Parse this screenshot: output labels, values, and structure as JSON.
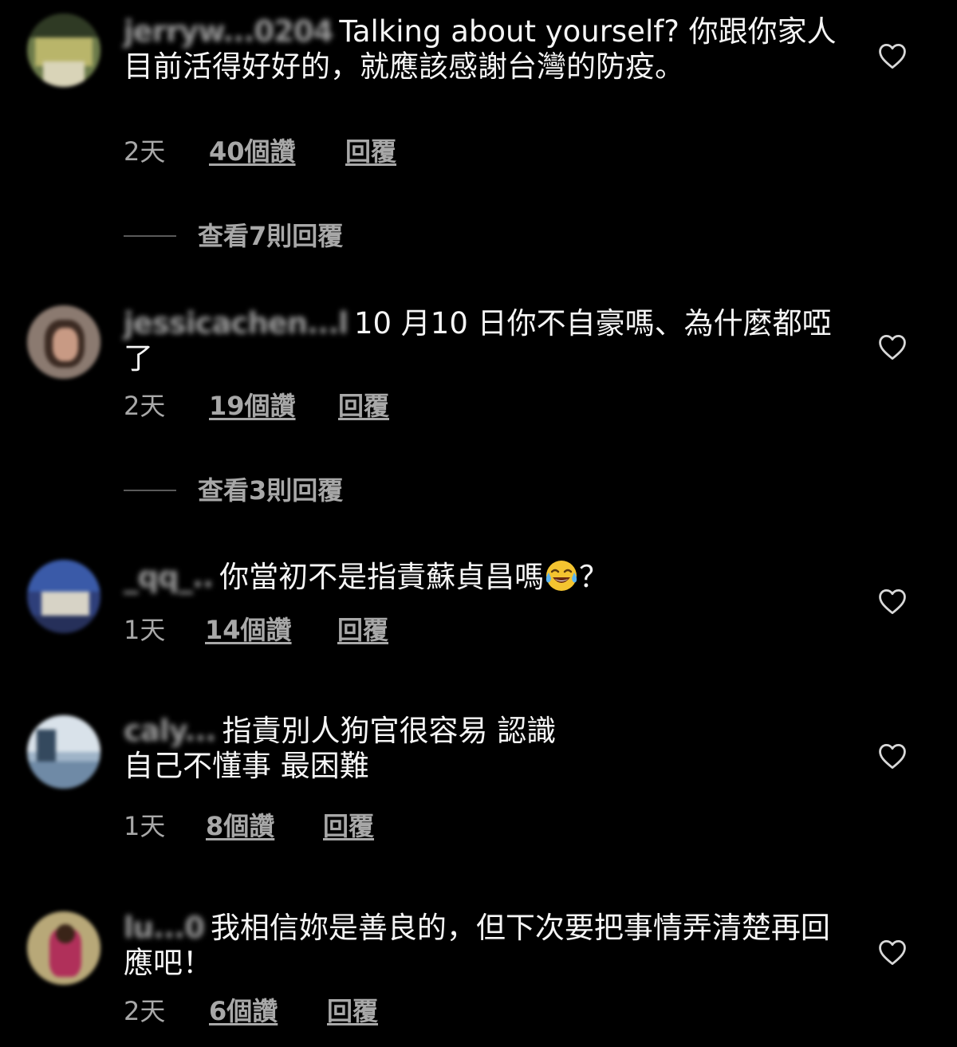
{
  "colors": {
    "background": "#000000",
    "text": "#f5f5f5",
    "meta": "#a8a8a8",
    "divider": "#5a5a5a"
  },
  "comments": [
    {
      "username": "jerryw...0204",
      "text": "Talking about yourself? 你跟你家人目前活得好好的，就應該感謝台灣的防疫。",
      "time": "2天",
      "likes": "40個讚",
      "reply": "回覆",
      "view_replies": "查看7則回覆",
      "icon": "heart-outline-icon"
    },
    {
      "username": "jessicachen...l",
      "text": "10 月10 日你不自豪嗎、為什麼都啞了",
      "time": "2天",
      "likes": "19個讚",
      "reply": "回覆",
      "view_replies": "查看3則回覆",
      "icon": "heart-outline-icon"
    },
    {
      "username": "_qq_..",
      "text": "你當初不是指責蘇貞昌嗎",
      "emoji": "face-with-tears-of-joy",
      "text_after": "？",
      "time": "1天",
      "likes": "14個讚",
      "reply": "回覆",
      "icon": "heart-outline-icon"
    },
    {
      "username": "caly...",
      "text": "指責別人狗官很容易 認識自己不懂事 最困難",
      "time": "1天",
      "likes": "8個讚",
      "reply": "回覆",
      "icon": "heart-outline-icon"
    },
    {
      "username": "lu...0",
      "text": "我相信妳是善良的，但下次要把事情弄清楚再回應吧！",
      "time": "2天",
      "likes": "6個讚",
      "reply": "回覆",
      "icon": "heart-outline-icon"
    }
  ]
}
